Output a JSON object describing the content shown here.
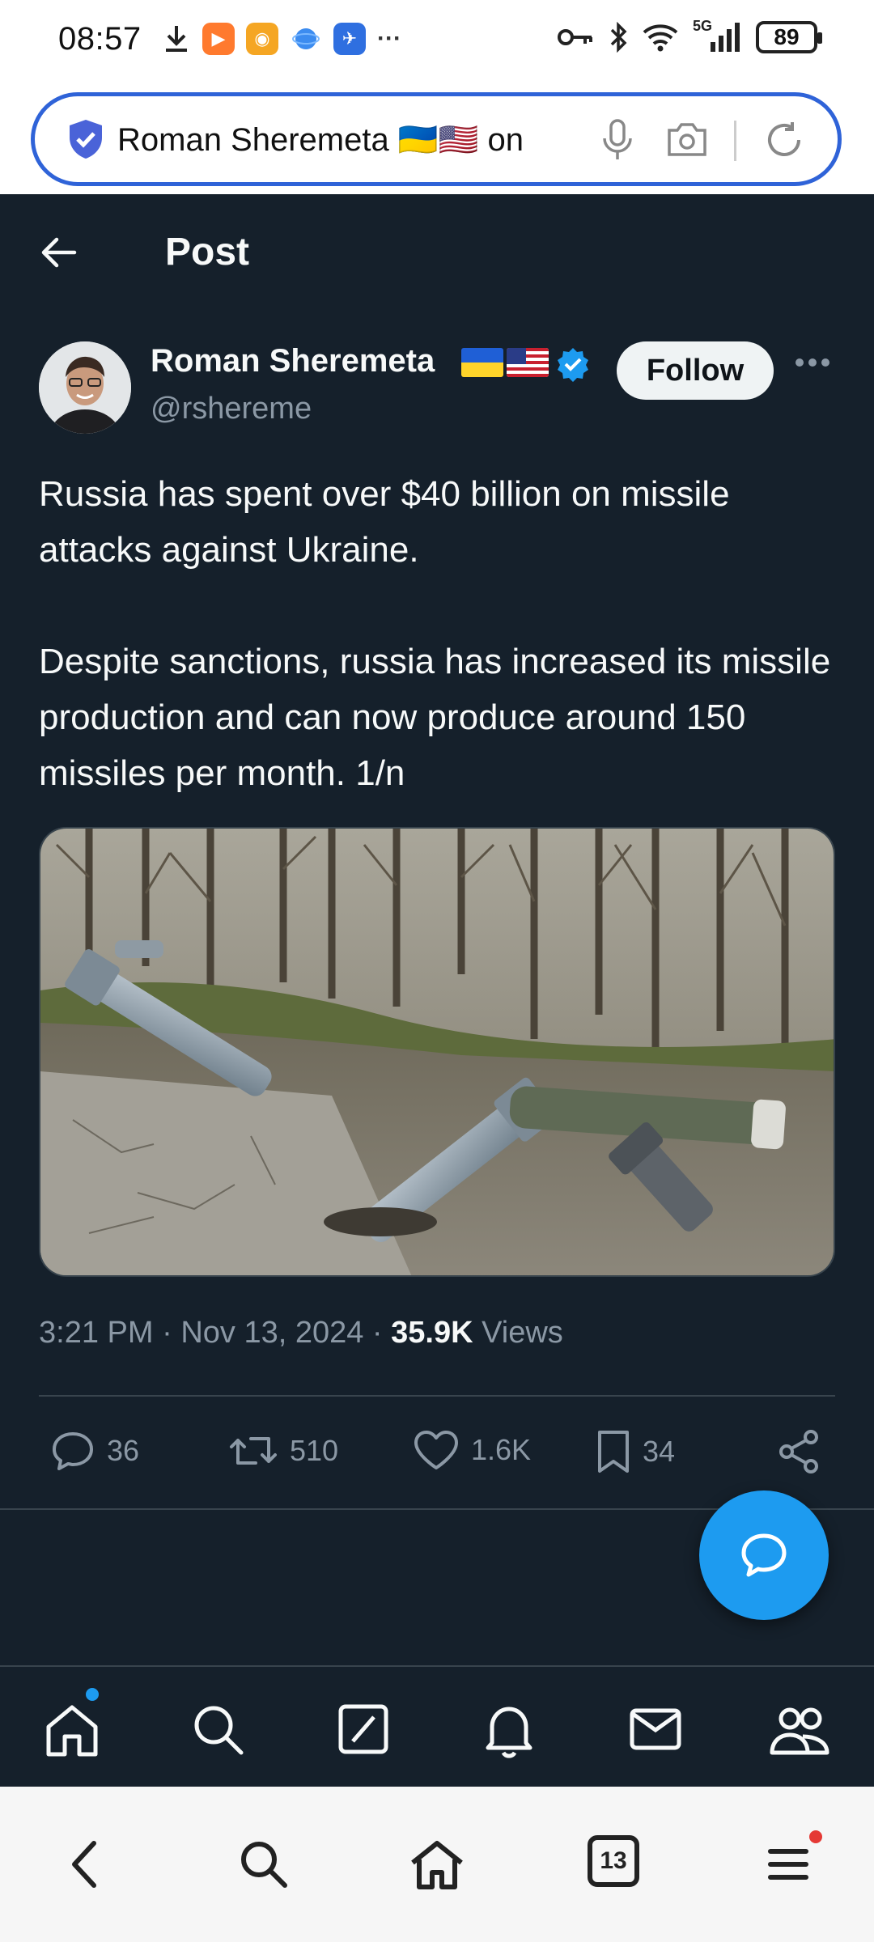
{
  "status_bar": {
    "time": "08:57",
    "network": "5G",
    "battery": "89",
    "overflow": "···"
  },
  "browser": {
    "url_text": "Roman Sheremeta 🇺🇦🇺🇸 on",
    "icons": [
      "shield-icon",
      "mic-icon",
      "camera-icon",
      "reload-icon"
    ]
  },
  "header": {
    "title": "Post"
  },
  "author": {
    "name": "Roman Sheremeta",
    "handle": "@rshereme",
    "follow_label": "Follow",
    "verified_color": "#1d9bf0"
  },
  "tweet": {
    "paragraphs": [
      "Russia has spent over $40 billion on missile attacks against Ukraine.",
      "Despite sanctions, russia has increased its missile production and can now produce around 150 missiles per month. 1/n"
    ]
  },
  "meta": {
    "time": "3:21 PM",
    "date": "Nov 13, 2024",
    "sep": " · ",
    "views_count": "35.9K",
    "views_label": "Views"
  },
  "actions": {
    "replies": "36",
    "reposts": "510",
    "likes": "1.6K",
    "bookmarks": "34"
  },
  "bottom_nav": [
    "home-icon",
    "search-icon",
    "grok-icon",
    "notifications-icon",
    "messages-icon",
    "communities-icon"
  ],
  "system_nav": {
    "tabs_count": "13"
  },
  "colors": {
    "background": "#15202b",
    "accent": "#1d9bf0",
    "text_primary": "#f7f9f9",
    "text_secondary": "#8b98a5"
  }
}
